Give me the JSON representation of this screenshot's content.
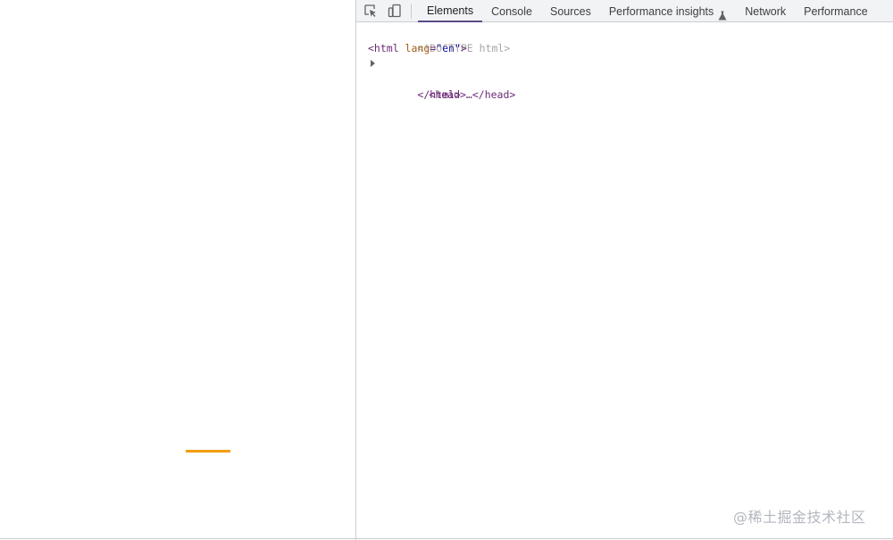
{
  "devtools": {
    "tabs": [
      {
        "label": "Elements"
      },
      {
        "label": "Console"
      },
      {
        "label": "Sources"
      },
      {
        "label": "Performance insights"
      },
      {
        "label": "Network"
      },
      {
        "label": "Performance"
      }
    ],
    "active_tab": "Elements",
    "icons": {
      "inspect": "inspect-element-icon",
      "device": "device-toolbar-icon",
      "experimental": "flask-icon"
    },
    "dom": {
      "doctype": "<!DOCTYPE html>",
      "html_open_start": "<html ",
      "html_lang_attr": "lang",
      "html_lang_value": "\"en\"",
      "html_open_end": ">",
      "head_collapsed": "<head>…</head>",
      "html_close": "</html>"
    }
  },
  "watermark": "@稀土掘金技术社区",
  "colors": {
    "accent": "#5f4a8b",
    "orange_bar": "#f29d12",
    "tag": "#6b2a76",
    "attr_name": "#a35e15",
    "attr_value": "#1a1aa6"
  }
}
